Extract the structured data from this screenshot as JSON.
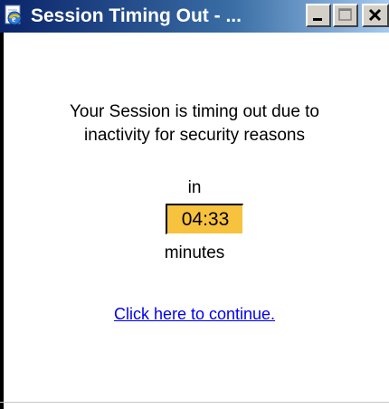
{
  "window": {
    "title": "Session Timing Out - ...",
    "icon": "ie-window-icon",
    "controls": [
      "minimize-icon",
      "maximize-icon",
      "close-icon"
    ]
  },
  "dialog": {
    "message_line1": "Your Session is timing out due to",
    "message_line2": "inactivity for security reasons",
    "in_label": "in",
    "countdown": "04:33",
    "minutes_label": "minutes",
    "continue_link": "Click here to continue."
  },
  "colors": {
    "titlebar_start": "#0a246a",
    "titlebar_end": "#a6caf0",
    "countdown_background": "#f7c23e",
    "link": "#0000ee"
  }
}
